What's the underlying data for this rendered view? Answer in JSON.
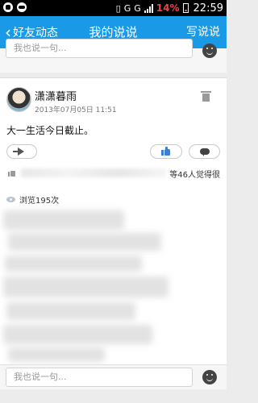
{
  "status_bar": {
    "network_labels": [
      "G",
      "G"
    ],
    "battery": "14%",
    "time": "22:59",
    "accent": "#e44"
  },
  "nav": {
    "back_label": "好友动态",
    "title": "我的说说",
    "action_label": "写说说",
    "color": "#1a9ae6"
  },
  "top_comment_bar": {
    "placeholder": "我也说一句..."
  },
  "post": {
    "username": "潇潇暮雨",
    "timestamp": "2013年07月05日 11:51",
    "text": "大一生活今日截止。",
    "likes_summary": "等46人觉得很",
    "views": "浏览195次"
  },
  "bottom_comment_bar": {
    "placeholder": "我也说一句..."
  },
  "icons": [
    "back-chevron-icon",
    "trash-icon",
    "share-icon",
    "like-thumb-icon",
    "comment-bubble-icon",
    "eye-icon",
    "emoji-icon"
  ]
}
